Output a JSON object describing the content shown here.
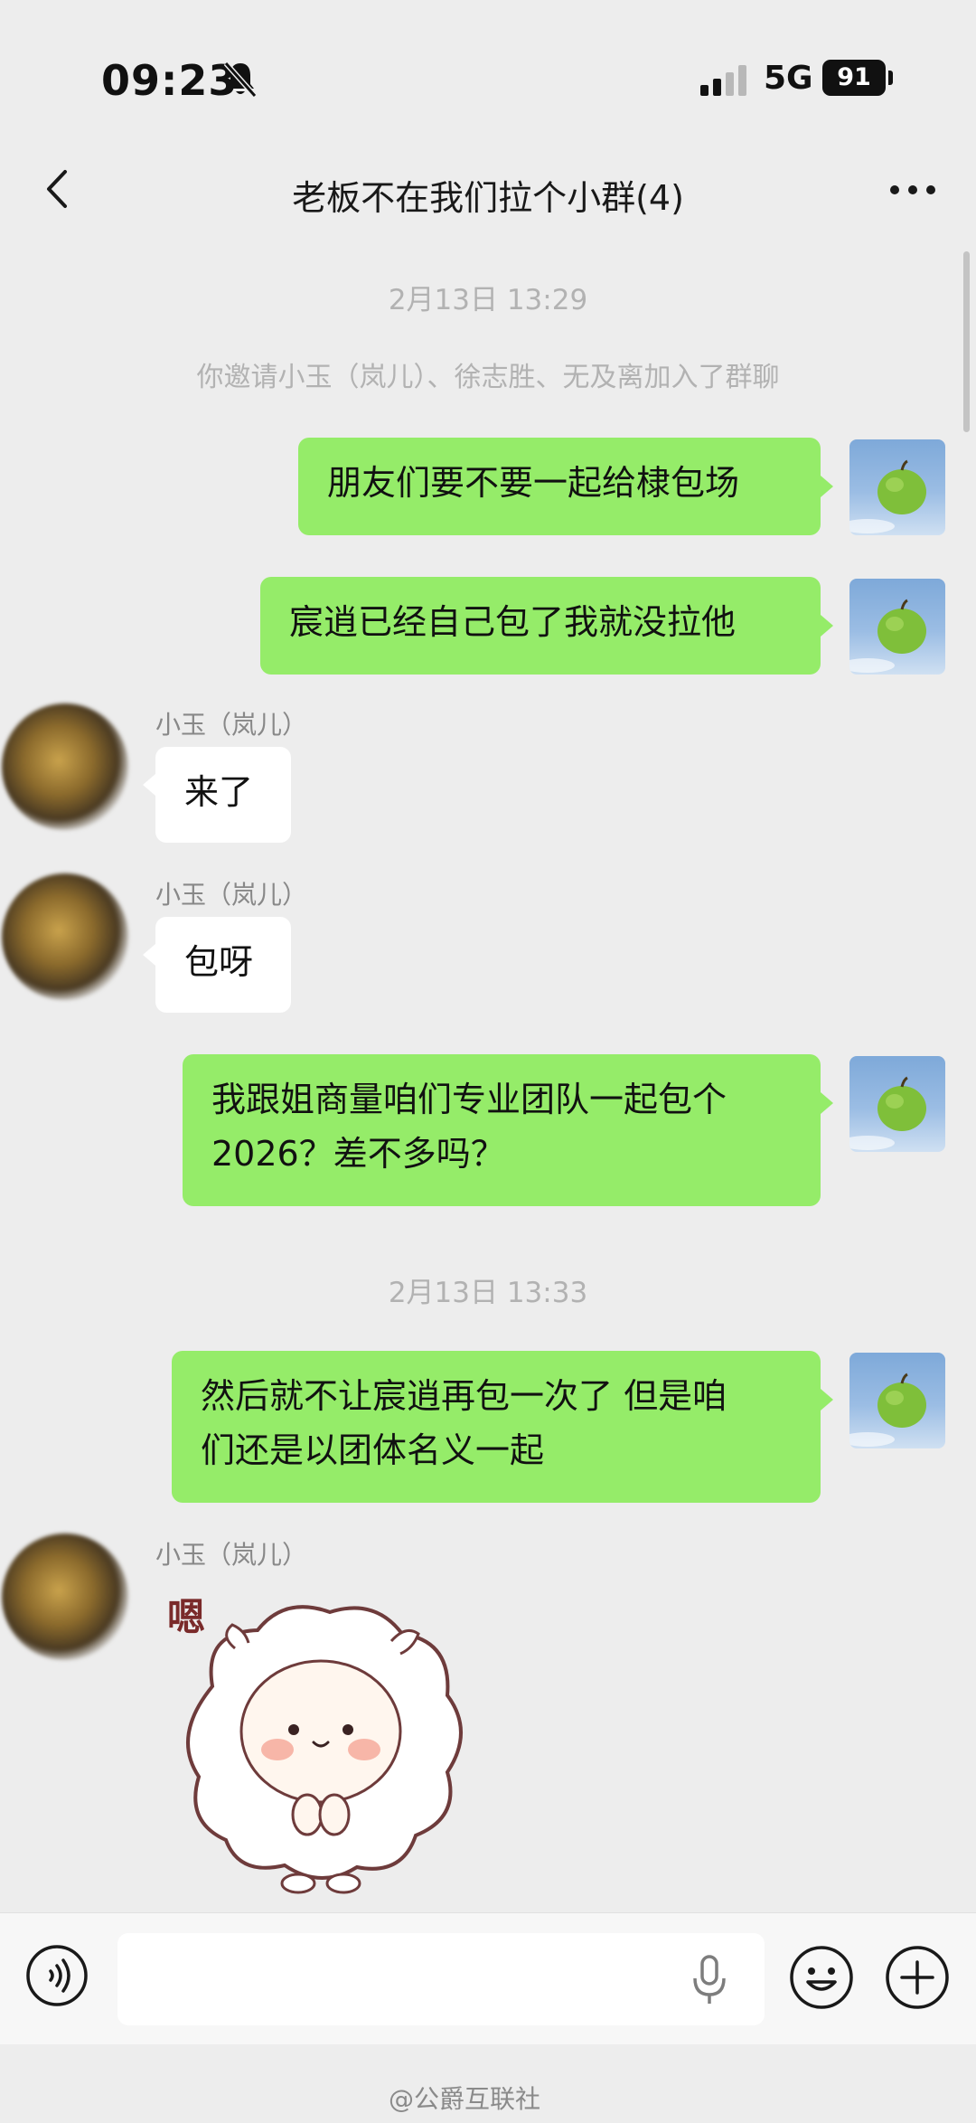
{
  "status_bar": {
    "time": "09:23",
    "network": "5G",
    "battery": "91"
  },
  "nav": {
    "title": "老板不在我们拉个小群(4)"
  },
  "timestamps": [
    "2月13日 13:29",
    "2月13日 13:33"
  ],
  "system_message": "你邀请小玉（岚儿）、徐志胜、无及离加入了群聊",
  "messages": [
    {
      "side": "right",
      "text": "朋友们要不要一起给棣包场"
    },
    {
      "side": "right",
      "text": "宸逍已经自己包了我就没拉他"
    },
    {
      "side": "left",
      "sender": "小玉（岚儿）",
      "text": "来了"
    },
    {
      "side": "left",
      "sender": "小玉（岚儿）",
      "text": "包呀"
    },
    {
      "side": "right",
      "line1": "我跟姐商量咱们专业团队一起包个",
      "line2": "2026？差不多吗？"
    },
    {
      "side": "right",
      "line1": "然后就不让宸逍再包一次了 但是咱",
      "line2": "们还是以团体名义一起"
    },
    {
      "side": "left",
      "sender": "小玉（岚儿）",
      "sticker": "sheep-sticker",
      "sticker_text": "嗯"
    }
  ],
  "input": {
    "placeholder": ""
  },
  "watermark": "@公爵互联社",
  "colors": {
    "my_bubble": "#95ec69",
    "their_bubble": "#ffffff",
    "background": "#ededed"
  }
}
